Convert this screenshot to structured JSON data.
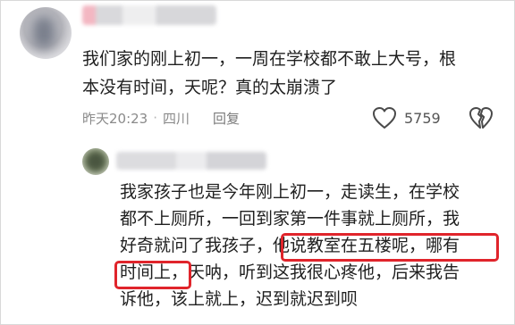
{
  "comment": {
    "text_line1": "我们家的刚上初一，一周在学校都不敢上大号，根",
    "text_line2": "本没有时间，天呢？真的太崩溃了",
    "time": "昨天20:23",
    "location": "四川",
    "separator": "·",
    "reply_label": "回复",
    "likes": "5759"
  },
  "reply": {
    "line1": "我家孩子也是今年刚上初一，走读生，在学校",
    "line2": "都不上厕所，一回到家第一件事就上厕所，我",
    "line3": "好奇就问了我孩子，他说教室在五楼呢，哪有",
    "line4": "时间上，天呐，听到这我很心疼他，后来我告",
    "line5": "诉他，该上就上，迟到就迟到呗"
  },
  "colors": {
    "highlight": "#e0242b",
    "meta_text": "#8a8a8a"
  },
  "icons": {
    "like": "heart-outline-icon",
    "dislike": "broken-heart-outline-icon"
  }
}
